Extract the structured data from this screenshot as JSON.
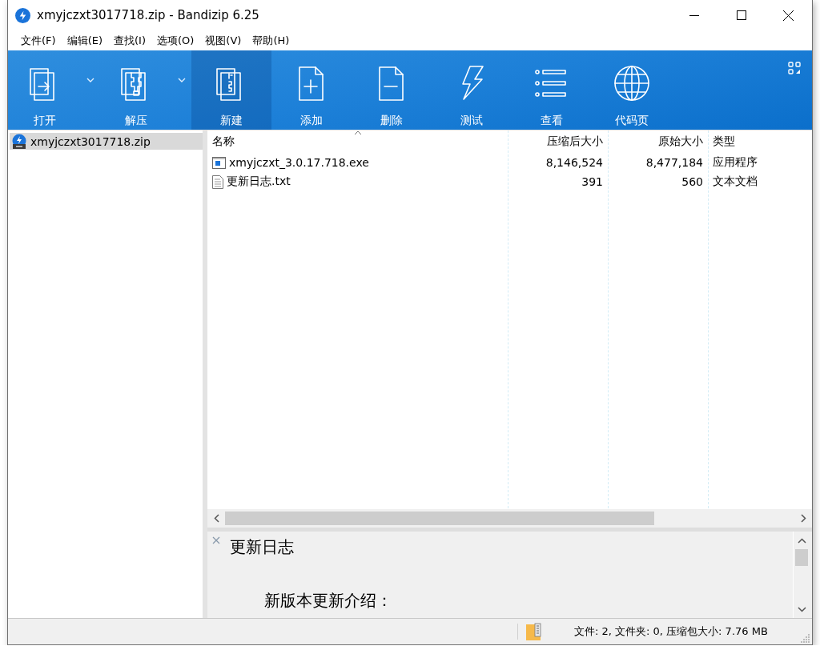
{
  "window": {
    "title": "xmyjczxt3017718.zip - Bandizip 6.25"
  },
  "menu": [
    "文件(F)",
    "编辑(E)",
    "查找(I)",
    "选项(O)",
    "视图(V)",
    "帮助(H)"
  ],
  "toolbar": [
    {
      "label": "打开",
      "kind": "open",
      "dropdown": true,
      "selected": false
    },
    {
      "label": "解压",
      "kind": "extract",
      "dropdown": true,
      "selected": false
    },
    {
      "label": "新建",
      "kind": "new",
      "dropdown": false,
      "selected": true
    },
    {
      "label": "添加",
      "kind": "add",
      "dropdown": false,
      "selected": false
    },
    {
      "label": "删除",
      "kind": "delete",
      "dropdown": false,
      "selected": false
    },
    {
      "label": "测试",
      "kind": "test",
      "dropdown": false,
      "selected": false
    },
    {
      "label": "查看",
      "kind": "view",
      "dropdown": false,
      "selected": false
    },
    {
      "label": "代码页",
      "kind": "codepage",
      "dropdown": false,
      "selected": false
    }
  ],
  "tree": [
    {
      "label": "xmyjczxt3017718.zip",
      "selected": true
    }
  ],
  "table": {
    "columns": [
      {
        "label": "名称",
        "sorted": true
      },
      {
        "label": "压缩后大小",
        "sorted": false
      },
      {
        "label": "原始大小",
        "sorted": false
      },
      {
        "label": "类型",
        "sorted": false
      }
    ],
    "rows": [
      {
        "kind": "exe",
        "cells": [
          "xmyjczxt_3.0.17.718.exe",
          "8,146,524",
          "8,477,184",
          "应用程序"
        ]
      },
      {
        "kind": "txt",
        "cells": [
          "更新日志.txt",
          "391",
          "560",
          "文本文档"
        ]
      }
    ]
  },
  "preview": {
    "title": "更新日志",
    "text": "新版本更新介绍："
  },
  "status_bar": {
    "text": "文件: 2, 文件夹: 0, 压缩包大小: 7.76 MB"
  }
}
